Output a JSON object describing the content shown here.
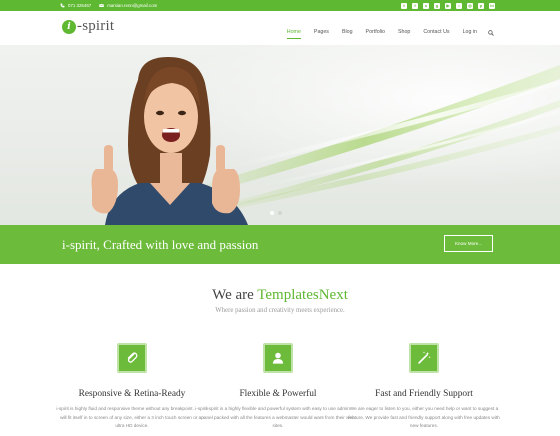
{
  "topbar": {
    "phone": "071 325467",
    "email": "marsian.renn@gmail.com",
    "socials": [
      {
        "icon": "twitter-icon",
        "glyph": "t"
      },
      {
        "icon": "facebook-icon",
        "glyph": "f"
      },
      {
        "icon": "skype-icon",
        "glyph": "s"
      },
      {
        "icon": "google-plus-icon",
        "glyph": "g"
      },
      {
        "icon": "youtube-icon",
        "glyph": "▶"
      },
      {
        "icon": "flickr-icon",
        "glyph": "•"
      },
      {
        "icon": "instagram-icon",
        "glyph": "◎"
      },
      {
        "icon": "pinterest-icon",
        "glyph": "p"
      },
      {
        "icon": "linkedin-icon",
        "glyph": "in"
      }
    ]
  },
  "header": {
    "logo_mark": "i",
    "logo_text": "-spirit",
    "nav": [
      "Home",
      "Pages",
      "Blog",
      "Portfolio",
      "Shop",
      "Contact Us",
      "Log in"
    ],
    "active_nav": "Home"
  },
  "band": {
    "tagline": "i-spirit, Crafted with love and passion",
    "button": "Know More..."
  },
  "intro": {
    "title_prefix": "We are ",
    "title_brand": "TemplatesNext",
    "subtitle": "Where passion and creativity meets experience."
  },
  "features": [
    {
      "icon": "paperclip-icon",
      "title": "Responsive & Retina-Ready",
      "desc": "i-spirit is highly fluid and responsive theme without any breakpoint. i-spirit will fit itself in to screen of any size, either a 3 inch touch screen or an ultra HD device."
    },
    {
      "icon": "user-icon",
      "title": "Flexible & Powerful",
      "desc": "i-spirit is a highly flexible and powerful system with easy to use admin panel packed with all the features a webmaster would want from their web sites."
    },
    {
      "icon": "magic-wand-icon",
      "title": "Fast and Friendly Support",
      "desc": "We are eager to listen to you, either you need help or want to suggest a feature. We provide fast and friendly support along with free updates with new features."
    }
  ],
  "colors": {
    "brand_green": "#5fb832",
    "band_green": "#6dbb3a"
  }
}
